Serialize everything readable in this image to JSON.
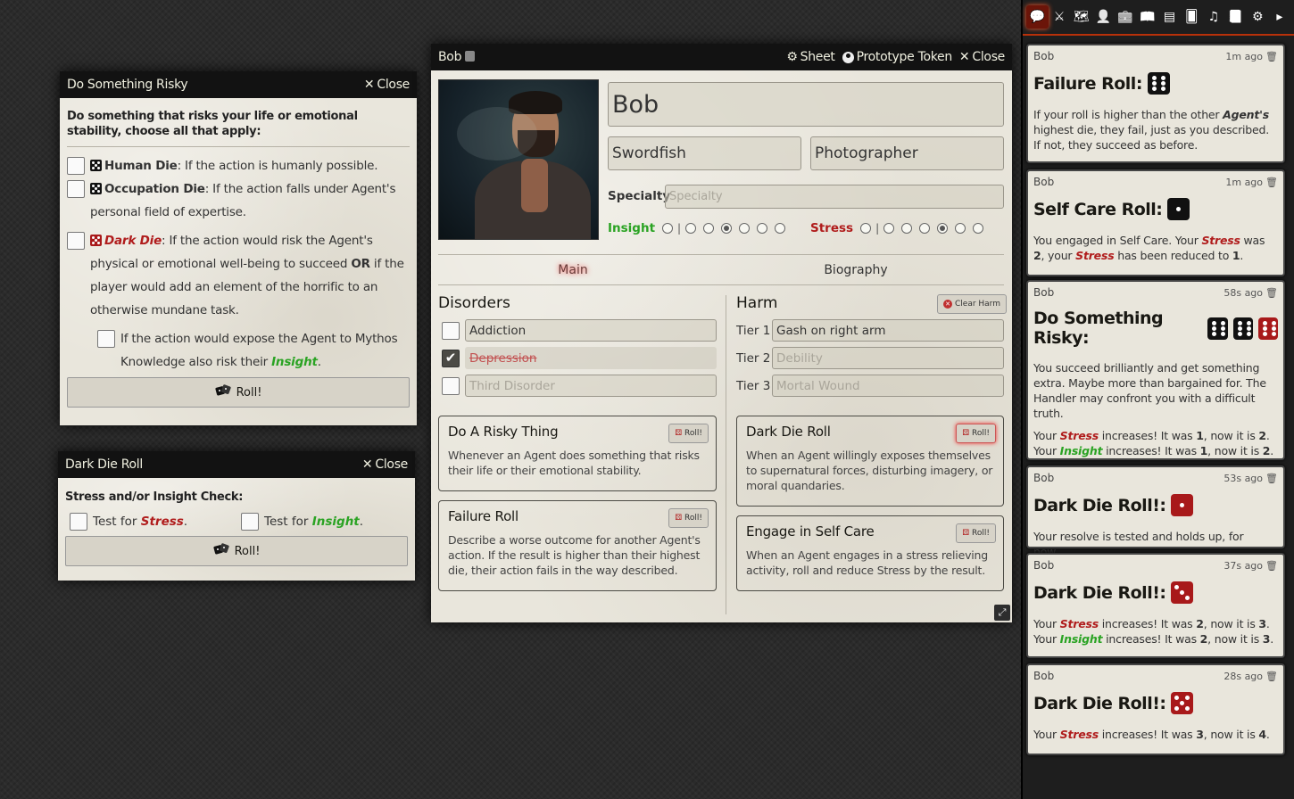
{
  "risky": {
    "title": "Do Something Risky",
    "close": "Close",
    "intro": "Do something that risks your life or emotional stability, choose all that apply:",
    "human_label": "Human Die",
    "human_text": ": If the action is humanly possible.",
    "occ_label": "Occupation Die",
    "occ_text": ": If the action falls under Agent's personal field of expertise.",
    "dark_label": "Dark Die",
    "dark_text1": ": If the action would risk the Agent's physical or emotional well-being to succeed ",
    "dark_or": "OR",
    "dark_text2": " if the player would add an element of the horrific to an otherwise mundane task.",
    "mythos_text": "If the action would expose the Agent to Mythos Knowledge also risk their ",
    "mythos_word": "Insight",
    "period": ".",
    "roll": "Roll!"
  },
  "darkroll": {
    "title": "Dark Die Roll",
    "close": "Close",
    "check": "Stress and/or Insight Check:",
    "test_for": "Test for ",
    "stress": "Stress",
    "insight": "Insight",
    "period": ".",
    "roll": "Roll!"
  },
  "sheet": {
    "title": "Bob",
    "sheet_btn": "Sheet",
    "token_btn": "Prototype Token",
    "close": "Close",
    "name": "Bob",
    "field1": "Swordfish",
    "field2": "Photographer",
    "specialty_label": "Specialty",
    "specialty_ph": "Specialty",
    "insight_label": "Insight",
    "stress_label": "Stress",
    "insight_value": 3,
    "stress_value": 4,
    "tab_main": "Main",
    "tab_bio": "Biography",
    "disorders_title": "Disorders",
    "disorders": [
      "Addiction",
      "Depression",
      "Third Disorder"
    ],
    "harm_title": "Harm",
    "clear_harm": "Clear Harm",
    "tier1": "Tier 1",
    "tier1_value": "Gash on right arm",
    "tier2": "Tier 2",
    "tier2_ph": "Debility",
    "tier3": "Tier 3",
    "tier3_ph": "Mortal Wound",
    "roll": "Roll!",
    "cards": [
      {
        "title": "Do A Risky Thing",
        "text": "Whenever an Agent does something that risks their life or their emotional stability."
      },
      {
        "title": "Failure Roll",
        "text": "Describe a worse outcome for another Agent's action. If the result is higher than their highest die, their action fails in the way described."
      },
      {
        "title": "Dark Die Roll",
        "text": "When an Agent willingly exposes themselves to supernatural forces, disturbing imagery, or moral quandaries."
      },
      {
        "title": "Engage in Self Care",
        "text": "When an Agent engages in a stress relieving activity, roll and reduce Stress by the result."
      }
    ]
  },
  "chat": [
    {
      "speaker": "Bob",
      "time": "1m ago",
      "title": "Failure Roll:",
      "b1": "If your roll is higher than the other ",
      "b2": "Agent's",
      "b3": " highest die, they fail, just as you described. If not, they succeed as before."
    },
    {
      "speaker": "Bob",
      "time": "1m ago",
      "title": "Self Care Roll:",
      "b1": "You engaged in Self Care. Your ",
      "stress": "Stress",
      "b2": " was ",
      "v1": "2",
      "b3": ", your ",
      "b4": " has been reduced to ",
      "v2": "1",
      "b5": "."
    },
    {
      "speaker": "Bob",
      "time": "58s ago",
      "title": "Do Something Risky:",
      "b1": "You succeed brilliantly and get something extra. Maybe more than bargained for. The Handler may confront you with a difficult truth.",
      "l1a": "Your ",
      "stress": "Stress",
      "l1b": " increases! It was ",
      "v1": "1",
      "l1c": ", now it is ",
      "v2": "2",
      "insight": "Insight",
      "v3": "1",
      "v4": "2",
      "dot": "."
    },
    {
      "speaker": "Bob",
      "time": "53s ago",
      "title": "Dark Die Roll!:",
      "b1": "Your resolve is tested and holds up, for now..."
    },
    {
      "speaker": "Bob",
      "time": "37s ago",
      "title": "Dark Die Roll!:",
      "l1a": "Your ",
      "stress": "Stress",
      "l1b": " increases! It was ",
      "l1c": ", now it is ",
      "v1": "2",
      "v2": "3",
      "insight": "Insight",
      "v3": "2",
      "v4": "3",
      "dot": "."
    },
    {
      "speaker": "Bob",
      "time": "28s ago",
      "title": "Dark Die Roll!:",
      "l1a": "Your ",
      "stress": "Stress",
      "l1b": " increases! It was ",
      "l1c": ", now it is ",
      "v1": "3",
      "v2": "4",
      "dot": "."
    }
  ],
  "sidebar_tabs": [
    "chat-icon",
    "combat-icon",
    "scenes-icon",
    "actors-icon",
    "items-icon",
    "journal-icon",
    "tables-icon",
    "cards-icon",
    "playlists-icon",
    "compendium-icon",
    "settings-icon",
    "collapse-icon"
  ]
}
